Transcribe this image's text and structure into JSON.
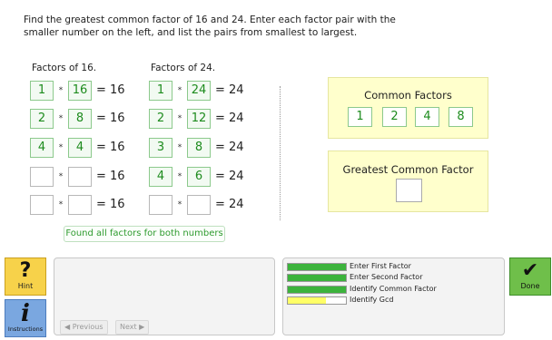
{
  "instructions": {
    "line1": "Find the greatest common factor of 16 and 24. Enter each factor pair with the",
    "line2": "smaller number on the left, and list the pairs from smallest to largest."
  },
  "factors16": {
    "header": "Factors of 16.",
    "rows": [
      {
        "a": "1",
        "b": "16",
        "eq": "= 16"
      },
      {
        "a": "2",
        "b": "8",
        "eq": "= 16"
      },
      {
        "a": "4",
        "b": "4",
        "eq": "= 16"
      },
      {
        "a": "",
        "b": "",
        "eq": "= 16"
      },
      {
        "a": "",
        "b": "",
        "eq": "= 16"
      }
    ]
  },
  "factors24": {
    "header": "Factors of 24.",
    "rows": [
      {
        "a": "1",
        "b": "24",
        "eq": "= 24"
      },
      {
        "a": "2",
        "b": "12",
        "eq": "= 24"
      },
      {
        "a": "3",
        "b": "8",
        "eq": "= 24"
      },
      {
        "a": "4",
        "b": "6",
        "eq": "= 24"
      },
      {
        "a": "",
        "b": "",
        "eq": "= 24"
      }
    ]
  },
  "multiply_symbol": "*",
  "found_label": "Found all factors for both numbers",
  "common_factors": {
    "title": "Common Factors",
    "values": [
      "1",
      "2",
      "4",
      "8"
    ]
  },
  "gcf": {
    "title": "Greatest Common Factor",
    "value": ""
  },
  "buttons": {
    "hint": {
      "glyph": "?",
      "label": "Hint"
    },
    "instructions": {
      "glyph": "i",
      "label": "Instructions"
    },
    "done": {
      "glyph": "✔",
      "label": "Done"
    },
    "previous": "◀ Previous",
    "next": "Next ▶"
  },
  "progress": {
    "steps": [
      {
        "label": "Enter First Factor",
        "value": 1.0
      },
      {
        "label": "Enter Second Factor",
        "value": 1.0
      },
      {
        "label": "Identify Common Factor",
        "value": 1.0
      },
      {
        "label": "Identify Gcd",
        "value": 0.65
      }
    ],
    "colors": {
      "complete": "#3cb33c",
      "partial": "#ffff66"
    }
  }
}
